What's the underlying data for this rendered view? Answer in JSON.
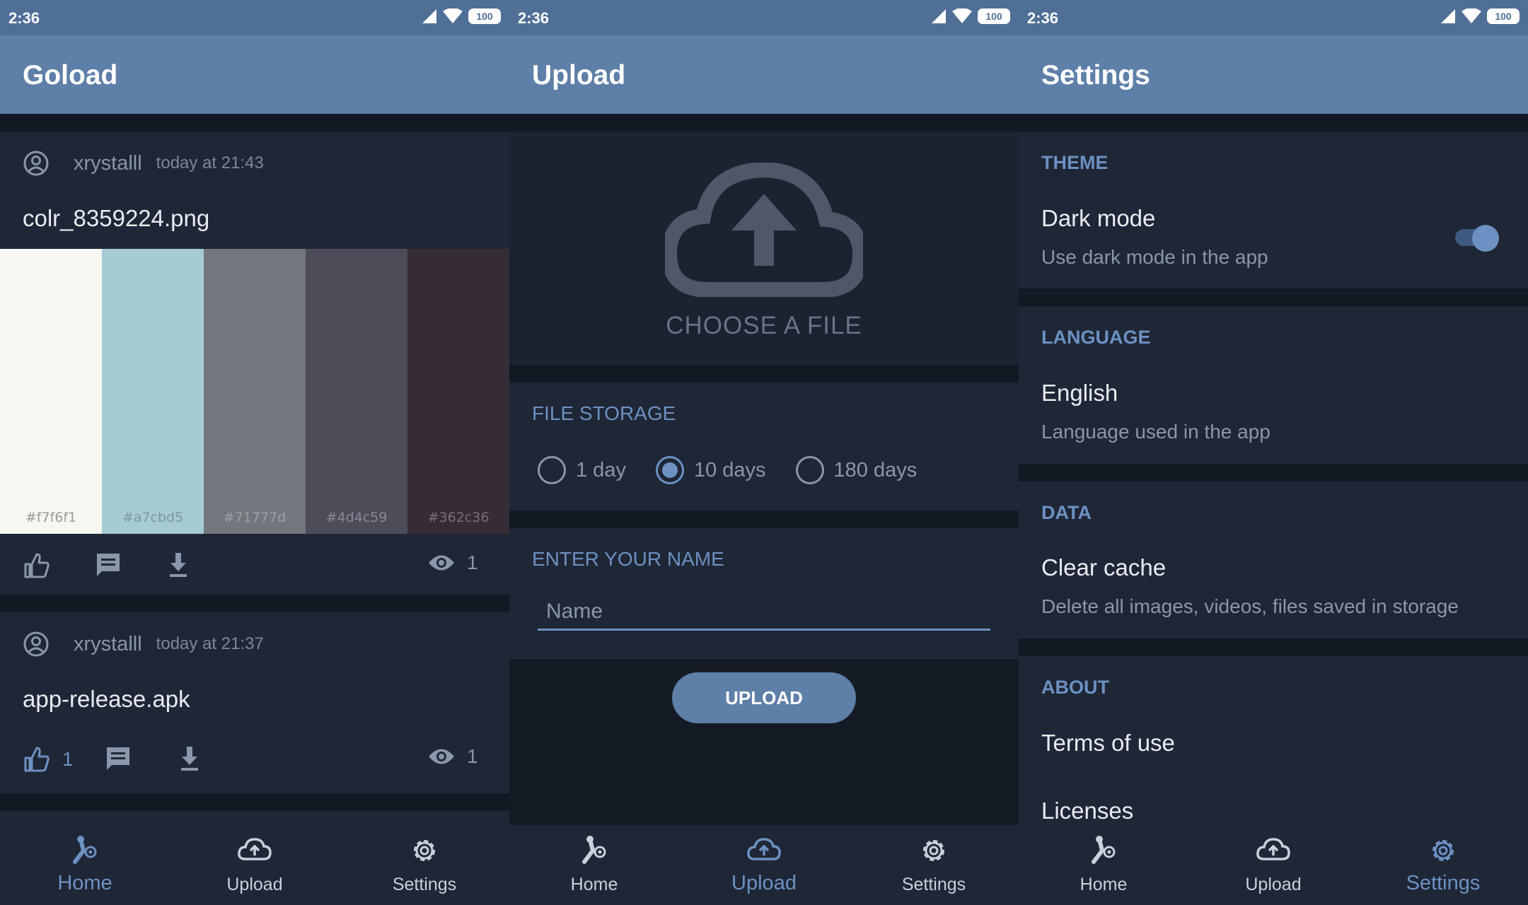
{
  "status_bar": {
    "time": "2:36",
    "battery": "100"
  },
  "home": {
    "title": "Goload",
    "posts": [
      {
        "user": "xrystalll",
        "time": "today at 21:43",
        "filename": "colr_8359224.png",
        "palette": [
          {
            "hex": "#f7f6f1",
            "label": "#f7f6f1"
          },
          {
            "hex": "#a7cbd5",
            "label": "#a7cbd5"
          },
          {
            "hex": "#71777d",
            "label": "#71777d"
          },
          {
            "hex": "#4d4c59",
            "label": "#4d4c59"
          },
          {
            "hex": "#362c36",
            "label": "#362c36"
          }
        ],
        "views": "1"
      },
      {
        "user": "xrystalll",
        "time": "today at 21:37",
        "filename": "app-release.apk",
        "likes": "1",
        "views": "1"
      }
    ]
  },
  "upload": {
    "title": "Upload",
    "choose_label": "CHOOSE A FILE",
    "storage_label": "FILE STORAGE",
    "storage_options": [
      "1 day",
      "10 days",
      "180 days"
    ],
    "storage_selected": "10 days",
    "name_label": "ENTER YOUR NAME",
    "name_placeholder": "Name",
    "upload_button": "UPLOAD"
  },
  "settings": {
    "title": "Settings",
    "sections": {
      "theme": {
        "title": "THEME",
        "item": "Dark mode",
        "sub": "Use dark mode in the app",
        "toggle_on": true
      },
      "language": {
        "title": "LANGUAGE",
        "item": "English",
        "sub": "Language used in the app"
      },
      "data": {
        "title": "DATA",
        "item": "Clear cache",
        "sub": "Delete all images, videos, files saved in storage"
      },
      "about": {
        "title": "ABOUT",
        "items": [
          "Terms of use",
          "Licenses"
        ]
      }
    }
  },
  "nav": {
    "home": "Home",
    "upload": "Upload",
    "settings": "Settings"
  },
  "colors": {
    "accent": "#6c91c2",
    "appbar": "#5d7fa8",
    "statusbar": "#4f6f97",
    "card": "#1f2636",
    "background": "#131923"
  }
}
